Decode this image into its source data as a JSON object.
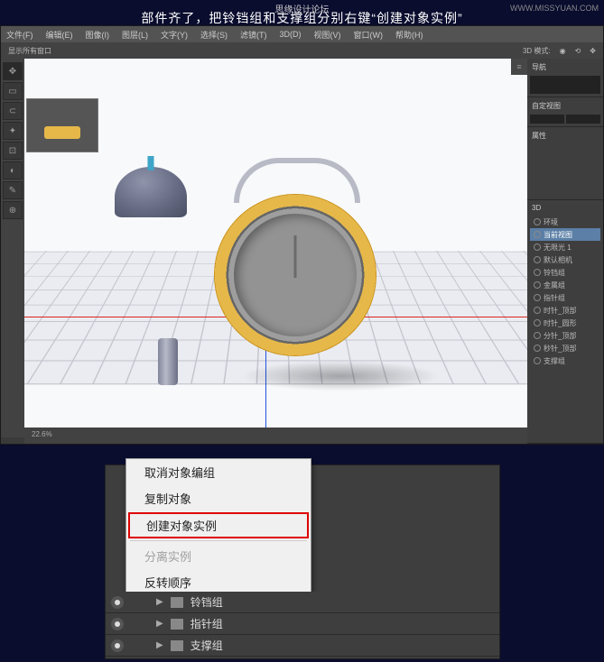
{
  "instruction": "部件齐了，把铃铛组和支撑组分别右键“创建对象实例”",
  "watermark": "WWW.MISSYUAN.COM",
  "logo": "思缘设计论坛",
  "menubar": [
    "文件(F)",
    "编辑(E)",
    "图像(I)",
    "图层(L)",
    "文字(Y)",
    "选择(S)",
    "滤镜(T)",
    "3D(D)",
    "视图(V)",
    "窗口(W)",
    "帮助(H)"
  ],
  "optbar": {
    "mode": "3D 模式:",
    "coords": "",
    "extra": "显示所有窗口"
  },
  "status": "22.6%",
  "rightPanel": {
    "nav": "导航",
    "p1": "自定视图",
    "p2": "属性",
    "p3": "3D",
    "layers": [
      {
        "t": "环境",
        "a": false
      },
      {
        "t": "当前视图",
        "a": true
      },
      {
        "t": "无限光 1",
        "a": false
      },
      {
        "t": "默认相机",
        "a": false
      },
      {
        "t": "铃铛组",
        "a": false
      },
      {
        "t": "金属组",
        "a": false
      },
      {
        "t": "指针组",
        "a": false
      },
      {
        "t": "时针_顶部",
        "a": false
      },
      {
        "t": "时针_圆形",
        "a": false
      },
      {
        "t": "分针_顶部",
        "a": false
      },
      {
        "t": "秒针_顶部",
        "a": false
      },
      {
        "t": "支撑组",
        "a": false
      }
    ]
  },
  "ctx": {
    "i1": "取消对象编组",
    "i2": "复制对象",
    "i3": "创建对象实例",
    "i4": "分离实例",
    "i5": "反转顺序"
  },
  "layerRows": [
    {
      "name": "铃铛组",
      "partial": true
    },
    {
      "name": "指针组",
      "partial": false
    },
    {
      "name": "支撑组",
      "partial": false
    }
  ]
}
